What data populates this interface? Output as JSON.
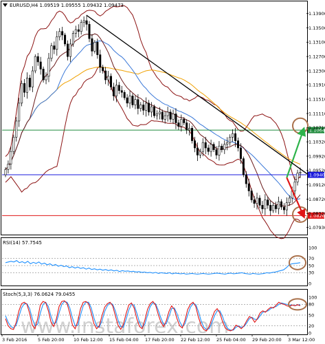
{
  "chart_data": {
    "type": "candlestick",
    "symbol_line": "EURUSD,H4 1.09519 1.09555 1.09432 1.09473",
    "watermark": "www.instaforex.com",
    "ylim": [
      1.0775,
      1.1422
    ],
    "y_ticks": [
      1.139,
      1.135,
      1.131,
      1.127,
      1.123,
      1.1191,
      1.1151,
      1.1111,
      1.1071,
      1.1032,
      1.0992,
      1.0952,
      1.0912,
      1.0872,
      1.0832,
      1.0793
    ],
    "y_tick_labels": [
      "1.13900",
      "1.13500",
      "1.13100",
      "1.12700",
      "1.12300",
      "1.11910",
      "1.11510",
      "1.11110",
      "1.10710",
      "1.10320",
      "1.09920",
      "1.09520",
      "1.09120",
      "1.08720",
      "1.08320",
      "1.07930"
    ],
    "levels": [
      {
        "value": 1.10647,
        "label": "1.10647",
        "color": "#1f8a3c"
      },
      {
        "value": 1.094,
        "label": "1.09400",
        "color": "#1a1adc"
      },
      {
        "value": 1.08261,
        "label": "1.08261",
        "color": "#e01616"
      }
    ],
    "x_tick_labels": [
      "3 Feb 2016",
      "5 Feb 20:00",
      "10 Feb 12:00",
      "15 Feb 04:00",
      "17 Feb 20:00",
      "22 Feb 12:00",
      "25 Feb 04:00",
      "29 Feb 20:00",
      "3 Mar 12:00"
    ],
    "close": [
      1.0955,
      1.097,
      1.1005,
      1.1045,
      1.109,
      1.114,
      1.1195,
      1.117,
      1.121,
      1.1185,
      1.123,
      1.127,
      1.1255,
      1.1235,
      1.1205,
      1.1215,
      1.1265,
      1.13,
      1.129,
      1.1325,
      1.134,
      1.133,
      1.1305,
      1.127,
      1.1305,
      1.1335,
      1.1345,
      1.134,
      1.1365,
      1.137,
      1.136,
      1.132,
      1.1285,
      1.131,
      1.1275,
      1.124,
      1.123,
      1.1205,
      1.1215,
      1.1185,
      1.116,
      1.119,
      1.1175,
      1.117,
      1.1155,
      1.114,
      1.116,
      1.1135,
      1.115,
      1.1125,
      1.1135,
      1.112,
      1.114,
      1.1115,
      1.113,
      1.1105,
      1.111,
      1.1115,
      1.1095,
      1.1105,
      1.1115,
      1.1095,
      1.111,
      1.1085,
      1.1075,
      1.1095,
      1.1085,
      1.1065,
      1.107,
      1.1035,
      1.1015,
      1.0995,
      1.1005,
      1.103,
      1.1015,
      1.1005,
      1.1025,
      1.101,
      1.0995,
      1.102,
      1.101,
      1.1025,
      1.103,
      1.1045,
      1.1055,
      1.1035,
      1.1015,
      1.0985,
      1.094,
      1.0915,
      1.0895,
      1.087,
      1.086,
      1.0875,
      1.0855,
      1.0845,
      1.087,
      1.0855,
      1.084,
      1.0855,
      1.0845,
      1.0865,
      1.085,
      1.0842,
      1.0862,
      1.0875,
      1.0895,
      1.092,
      1.0945,
      1.0947
    ],
    "markers": [
      {
        "type": "circle",
        "x_index": 109,
        "value": 1.1077,
        "color": "#a9704a"
      },
      {
        "type": "circle",
        "x_index": 109,
        "value": 1.0829,
        "color": "#a9704a"
      },
      {
        "type": "arrow",
        "from_index": 104,
        "from_value": 1.0932,
        "to_index": 110,
        "to_value": 1.1062,
        "color": "#2db34a"
      },
      {
        "type": "arrow",
        "from_index": 104,
        "from_value": 1.0932,
        "to_index": 110,
        "to_value": 1.0829,
        "color": "#e01616"
      },
      {
        "type": "trendline",
        "from_index": 30,
        "from_value": 1.1385,
        "to_index": 112,
        "to_value": 1.094,
        "color": "#000000"
      }
    ],
    "indicators": {
      "rsi": {
        "label": "RSI(14) 57.7545",
        "ylim": [
          0,
          100
        ],
        "levels": [
          70,
          50,
          30
        ],
        "tick_labels": [
          "100",
          "70",
          "50",
          "30",
          "0"
        ],
        "color": "#1e90ff",
        "values": [
          58,
          60,
          62,
          60,
          64,
          58,
          61,
          57,
          62,
          55,
          59,
          56,
          60,
          54,
          57,
          52,
          55,
          50,
          53,
          48,
          51,
          47,
          49,
          44,
          47,
          43,
          46,
          42,
          44,
          40,
          43,
          39,
          41,
          38,
          40,
          37,
          39,
          36,
          38,
          35,
          37,
          33,
          36,
          34,
          35,
          33,
          34,
          32,
          33,
          31,
          32,
          30,
          31,
          29,
          31,
          28,
          30,
          29,
          28,
          30,
          27,
          29,
          28,
          27,
          28,
          26,
          27,
          28,
          27,
          26,
          27,
          28,
          27,
          26,
          27,
          28,
          29,
          28,
          27,
          26,
          28,
          29,
          27,
          28,
          29,
          30,
          28,
          27,
          26,
          28,
          27,
          26,
          27,
          28,
          30,
          29,
          31,
          32,
          34,
          36,
          38,
          44,
          52,
          55,
          56,
          57,
          58
        ]
      },
      "stoch": {
        "label": "Stoch(5,3,3) 76.0624 79.0455",
        "ylim": [
          0,
          100
        ],
        "levels": [
          80,
          50,
          20
        ],
        "tick_labels": [
          "100",
          "80",
          "50",
          "20",
          "0"
        ],
        "main_color": "#e01616",
        "signal_color": "#1e90ff",
        "main": [
          40,
          20,
          12,
          10,
          30,
          62,
          82,
          86,
          80,
          55,
          22,
          12,
          40,
          78,
          88,
          85,
          62,
          30,
          18,
          40,
          74,
          88,
          90,
          82,
          55,
          22,
          12,
          34,
          68,
          86,
          88,
          82,
          56,
          26,
          12,
          20,
          48,
          72,
          82,
          86,
          76,
          48,
          22,
          10,
          24,
          54,
          78,
          84,
          70,
          40,
          18,
          12,
          36,
          66,
          82,
          88,
          78,
          52,
          30,
          18,
          34,
          60,
          76,
          66,
          40,
          20,
          14,
          36,
          66,
          80,
          86,
          74,
          44,
          22,
          10,
          6,
          18,
          40,
          60,
          68,
          56,
          32,
          14,
          8,
          6,
          10,
          22,
          18,
          12,
          20,
          34,
          46,
          42,
          30,
          40,
          56,
          62,
          58,
          66,
          72,
          70,
          78,
          86,
          82,
          80,
          76,
          74,
          78,
          76,
          79,
          76
        ],
        "signal": [
          48,
          30,
          18,
          14,
          22,
          46,
          70,
          82,
          82,
          68,
          40,
          20,
          24,
          56,
          80,
          86,
          74,
          46,
          26,
          30,
          56,
          80,
          88,
          86,
          70,
          42,
          20,
          22,
          50,
          76,
          86,
          86,
          70,
          42,
          20,
          16,
          34,
          60,
          76,
          84,
          80,
          62,
          36,
          18,
          16,
          38,
          64,
          80,
          78,
          56,
          30,
          16,
          24,
          50,
          74,
          84,
          82,
          64,
          42,
          24,
          26,
          46,
          68,
          70,
          54,
          32,
          18,
          26,
          50,
          72,
          82,
          80,
          60,
          34,
          16,
          10,
          12,
          28,
          48,
          62,
          62,
          46,
          24,
          12,
          8,
          8,
          16,
          20,
          16,
          18,
          28,
          40,
          44,
          38,
          38,
          48,
          58,
          60,
          62,
          68,
          72,
          74,
          80,
          84,
          82,
          80,
          78,
          78,
          77,
          78,
          79
        ]
      }
    }
  }
}
